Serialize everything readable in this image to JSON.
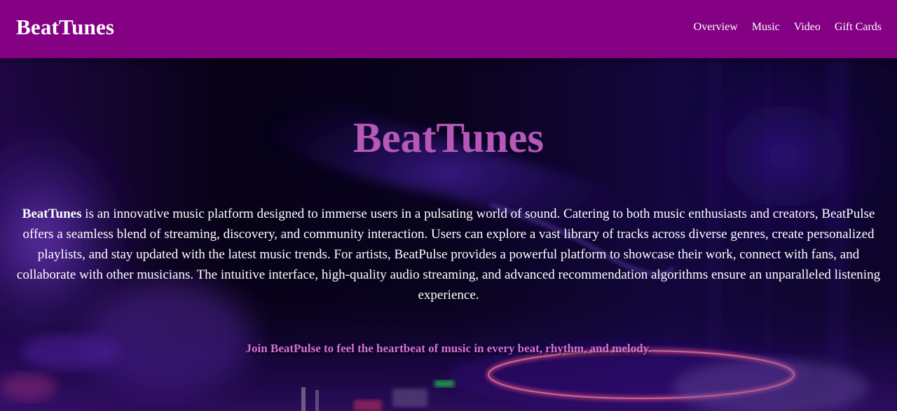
{
  "header": {
    "logo": "BeatTunes",
    "nav": [
      {
        "label": "Overview"
      },
      {
        "label": "Music"
      },
      {
        "label": "Video"
      },
      {
        "label": "Gift Cards"
      }
    ]
  },
  "hero": {
    "title": "BeatTunes",
    "description_brand": "BeatTunes",
    "description_text": " is an innovative music platform designed to immerse users in a pulsating world of sound. Catering to both music enthusiasts and creators, BeatPulse offers a seamless blend of streaming, discovery, and community interaction. Users can explore a vast library of tracks across diverse genres, create personalized playlists, and stay updated with the latest music trends. For artists, BeatPulse provides a powerful platform to showcase their work, connect with fans, and collaborate with other musicians. The intuitive interface, high-quality audio streaming, and advanced recommendation algorithms ensure an unparalleled listening experience.",
    "tagline": "Join BeatPulse to feel the heartbeat of music in every beat, rhythm, and melody.",
    "background_image": "dj-turntable-purple-neon-photo"
  },
  "colors": {
    "header_bg": "#840184",
    "title": "#b558b8",
    "tagline": "#d472d8",
    "text": "#ffffff"
  }
}
